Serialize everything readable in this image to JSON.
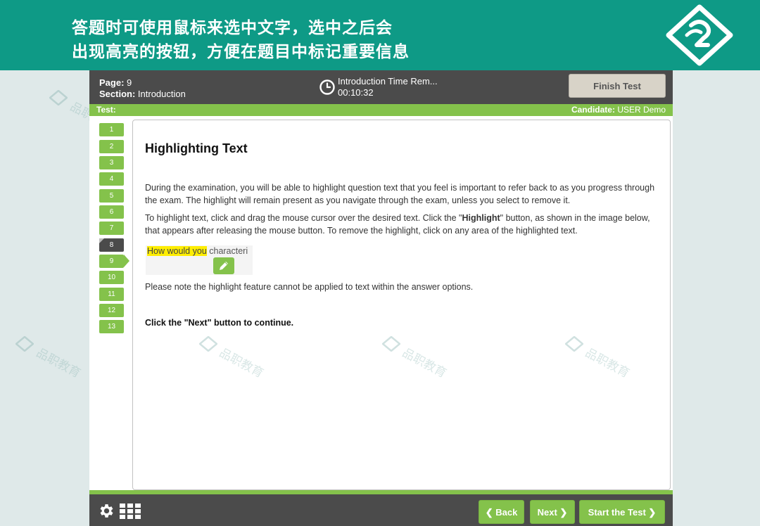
{
  "banner": {
    "line1": "答题时可使用鼠标来选中文字，选中之后会",
    "line2": "出现高亮的按钮，方便在题目中标记重要信息"
  },
  "header": {
    "page_label": "Page:",
    "page_value": "9",
    "section_label": "Section:",
    "section_value": "Introduction",
    "timer_title": "Introduction Time Rem...",
    "timer_value": "00:10:32",
    "finish_label": "Finish Test"
  },
  "status": {
    "test_label": "Test:",
    "candidate_label": "Candidate:",
    "candidate_value": "USER Demo"
  },
  "nav": {
    "items": [
      "1",
      "2",
      "3",
      "4",
      "5",
      "6",
      "7",
      "8",
      "9",
      "10",
      "11",
      "12",
      "13"
    ],
    "visited_index": 7,
    "current_index": 8
  },
  "content": {
    "title": "Highlighting Text",
    "para1": "During the examination, you will be able to highlight question text that you feel is important to refer back to as you progress through the exam. The highlight will remain present as you navigate through the exam, unless you select to remove it.",
    "para2_before": "To highlight text, click and drag the mouse cursor over the desired text. Click the \"",
    "para2_bold": "Highlight",
    "para2_after": "\" button, as shown in the image below, that appears after releasing the mouse button. To remove the highlight, click on any area of the highlighted text.",
    "demo_highlighted": "How would you",
    "demo_rest": " characteri",
    "para3": "Please note the highlight feature cannot be applied to text within the answer options.",
    "para4": "Click the \"Next\" button to continue."
  },
  "footer": {
    "back_label": "Back",
    "next_label": "Next",
    "start_label": "Start the Test"
  },
  "watermark": {
    "text": "品职教育"
  },
  "colors": {
    "banner": "#0e9a86",
    "accent_green": "#84c24b",
    "dark_bar": "#4b4b4b",
    "highlight": "#ffee00"
  }
}
